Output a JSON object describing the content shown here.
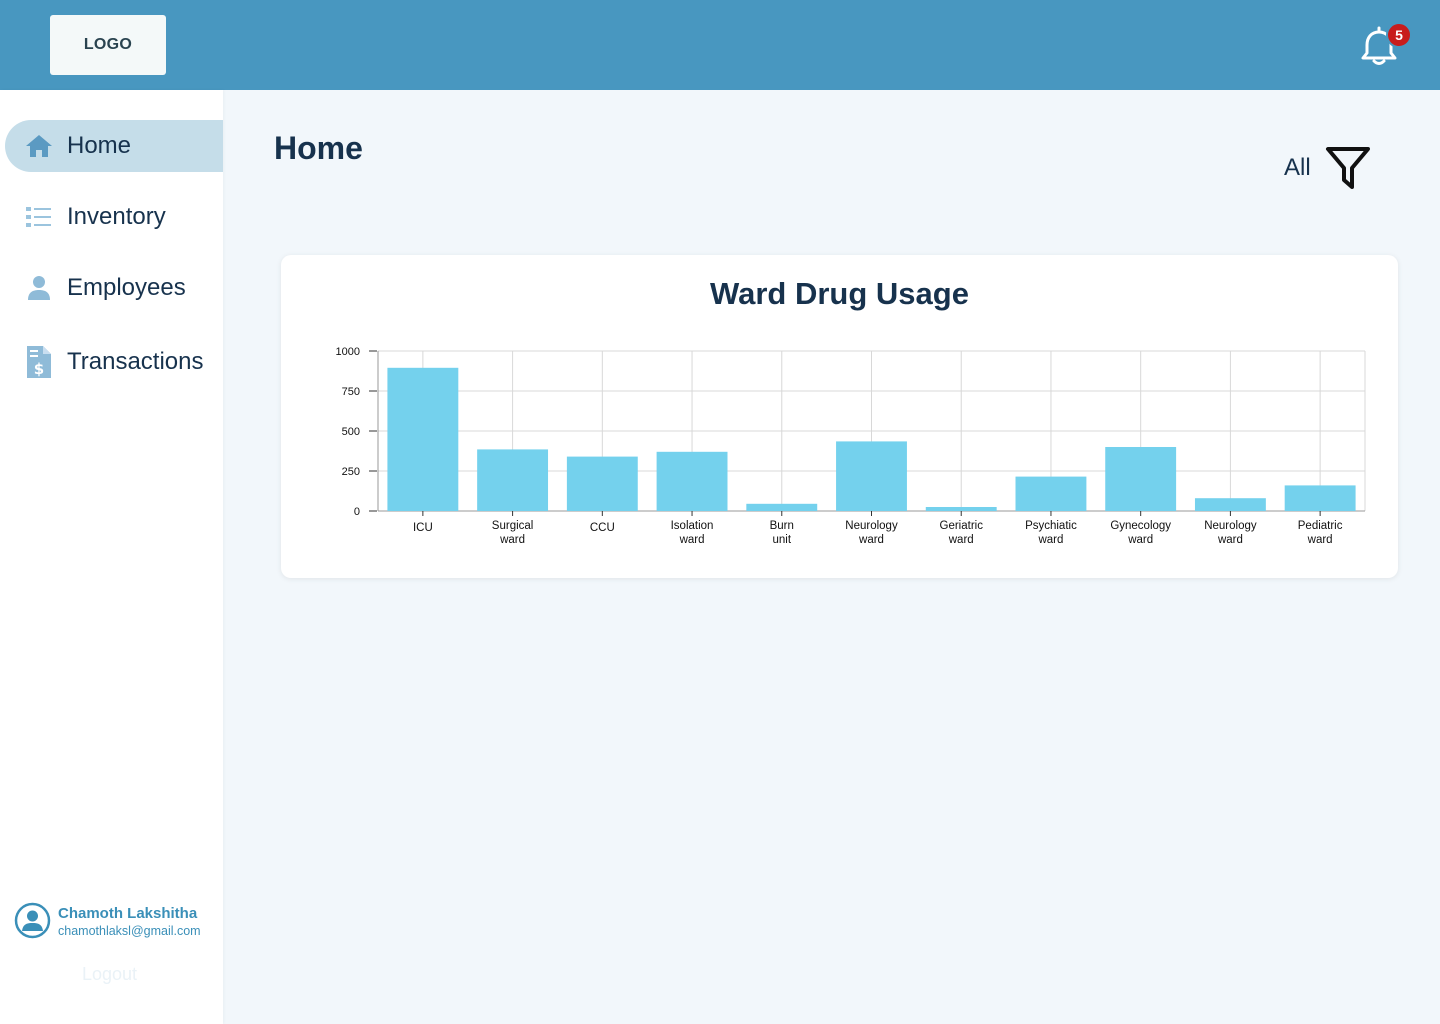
{
  "header": {
    "logo_text": "LOGO",
    "notification_count": "5"
  },
  "sidebar": {
    "items": [
      {
        "label": "Home",
        "icon": "home-icon",
        "active": true
      },
      {
        "label": "Inventory",
        "icon": "list-icon",
        "active": false
      },
      {
        "label": "Employees",
        "icon": "user-icon",
        "active": false
      },
      {
        "label": "Transactions",
        "icon": "invoice-dollar-icon",
        "active": false
      }
    ],
    "user": {
      "name": "Chamoth Lakshitha",
      "email": "chamothlaksl@gmail.com"
    },
    "logout_label": "Logout"
  },
  "main": {
    "title": "Home",
    "filter_label": "All"
  },
  "colors": {
    "topbar": "#4897c0",
    "bar": "#74d1ed",
    "active_nav": "#c5dde9",
    "badge": "#c81c1c"
  },
  "chart_data": {
    "type": "bar",
    "title": "Ward Drug Usage",
    "categories": [
      [
        "ICU"
      ],
      [
        "Surgical",
        "ward"
      ],
      [
        "CCU"
      ],
      [
        "Isolation",
        "ward"
      ],
      [
        "Burn",
        "unit"
      ],
      [
        "Neurology",
        "ward"
      ],
      [
        "Geriatric",
        "ward"
      ],
      [
        "Psychiatic",
        "ward"
      ],
      [
        "Gynecology",
        "ward"
      ],
      [
        "Neurology",
        "ward"
      ],
      [
        "Pediatric",
        "ward"
      ]
    ],
    "values": [
      895,
      385,
      340,
      370,
      45,
      435,
      25,
      215,
      400,
      80,
      160
    ],
    "yticks": [
      0,
      250,
      500,
      750,
      1000
    ],
    "ylim": [
      0,
      1000
    ],
    "grid": true,
    "xlabel": "",
    "ylabel": ""
  }
}
